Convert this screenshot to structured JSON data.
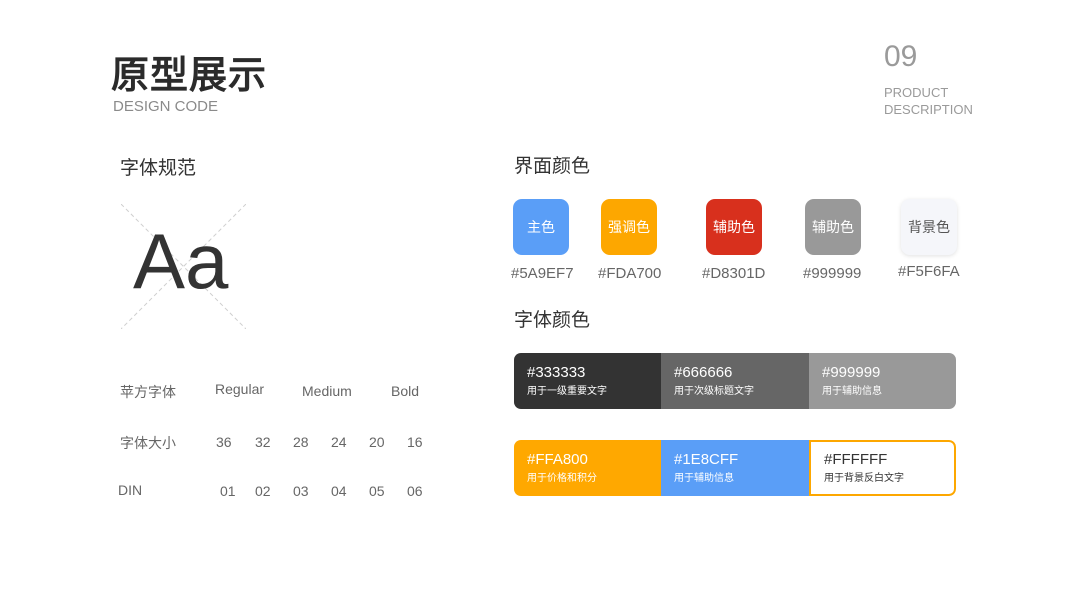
{
  "header": {
    "title": "原型展示",
    "subtitle": "DESIGN CODE",
    "page_number": "09",
    "product_line1": "PRODUCT",
    "product_line2": "DESCRIPTION"
  },
  "font_spec": {
    "title": "字体规范",
    "sample": "Aa",
    "rows": [
      {
        "label": "苹方字体",
        "values": [
          "Regular",
          "Medium",
          "Bold"
        ]
      },
      {
        "label": "字体大小",
        "values": [
          "36",
          "32",
          "28",
          "24",
          "20",
          "16"
        ]
      },
      {
        "label": "DIN",
        "values": [
          "01",
          "02",
          "03",
          "04",
          "05",
          "06"
        ]
      }
    ]
  },
  "ui_colors": {
    "title": "界面颜色",
    "swatches": [
      {
        "label": "主色",
        "hex": "#5A9EF7",
        "color": "#5A9EF7",
        "text_color": "#ffffff"
      },
      {
        "label": "强调色",
        "hex": "#FDA700",
        "color": "#FDA700",
        "text_color": "#ffffff"
      },
      {
        "label": "辅助色",
        "hex": "#D8301D",
        "color": "#D8301D",
        "text_color": "#ffffff"
      },
      {
        "label": "辅助色",
        "hex": "#999999",
        "color": "#999999",
        "text_color": "#ffffff"
      },
      {
        "label": "背景色",
        "hex": "#F5F6FA",
        "color": "#F5F6FA",
        "text_color": "#555555"
      }
    ]
  },
  "font_colors": {
    "title": "字体颜色",
    "row1": [
      {
        "hex": "#333333",
        "desc": "用于一级重要文字",
        "color": "#333333",
        "text_color": "#ffffff"
      },
      {
        "hex": "#666666",
        "desc": "用于次级标题文字",
        "color": "#666666",
        "text_color": "#ffffff"
      },
      {
        "hex": "#999999",
        "desc": "用于辅助信息",
        "color": "#999999",
        "text_color": "#ffffff"
      }
    ],
    "row2": [
      {
        "hex": "#FFA800",
        "desc": "用于价格和积分",
        "color": "#FFA800",
        "text_color": "#ffffff"
      },
      {
        "hex": "#1E8CFF",
        "desc": "用于辅助信息",
        "color": "#5A9EF7",
        "text_color": "#ffffff"
      },
      {
        "hex": "#FFFFFF",
        "desc": "用于背景反白文字",
        "color": "#FFFFFF",
        "text_color": "#333333"
      }
    ]
  }
}
